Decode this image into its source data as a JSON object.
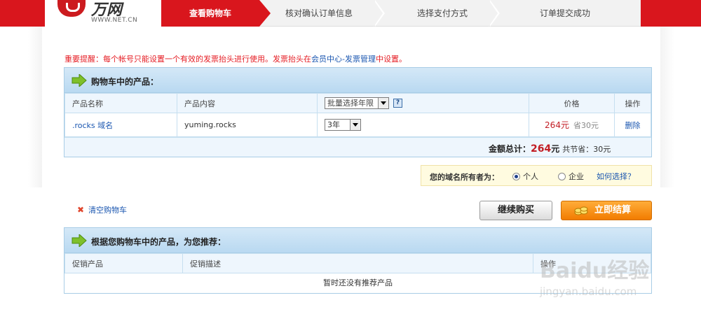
{
  "header": {
    "brand": "万网",
    "url": "WWW.NET.CN",
    "steps": [
      {
        "label": "查看购物车",
        "active": true
      },
      {
        "label": "核对确认订单信息",
        "active": false
      },
      {
        "label": "选择支付方式",
        "active": false
      },
      {
        "label": "订单提交成功",
        "active": false
      }
    ]
  },
  "notice": {
    "prefix": "重要提醒：每个帐号只能设置一个有效的发票抬头进行使用。发票抬头在",
    "link1": "会员中心",
    "dash": "-",
    "link2": "发票管理",
    "suffix": "中设置。"
  },
  "cart": {
    "title": "购物车中的产品：",
    "columns": {
      "name": "产品名称",
      "content": "产品内容",
      "batch_select": "批量选择年限",
      "help": "?",
      "price": "价格",
      "action": "操作"
    },
    "rows": [
      {
        "name": ".rocks 域名",
        "content": "yuming.rocks",
        "years": "3年",
        "price": "264元",
        "save": "省30元",
        "action": "删除"
      }
    ],
    "total_label": "金额总计：",
    "total_amount": "264",
    "total_unit": "元",
    "total_save": "共节省：30元"
  },
  "owner": {
    "label": "您的域名所有者为：",
    "options": [
      "个人",
      "企业"
    ],
    "selected": "个人",
    "help_link": "如何选择？"
  },
  "actions": {
    "clear_cart": "清空购物车",
    "continue": "继续购买",
    "checkout": "立即结算"
  },
  "recommend": {
    "title": "根据您购物车中的产品，为您推荐：",
    "columns": {
      "promo": "促销产品",
      "desc": "促销描述",
      "extra": "操作"
    },
    "empty": "暂时还没有推荐产品"
  },
  "watermark": {
    "text": "Baidu经验",
    "url": "jingyan.baidu.com"
  },
  "colors": {
    "brand_red": "#d9161d",
    "price_red": "#c21d24",
    "link_blue": "#1a56b0",
    "accent_orange": "#f27c00"
  }
}
